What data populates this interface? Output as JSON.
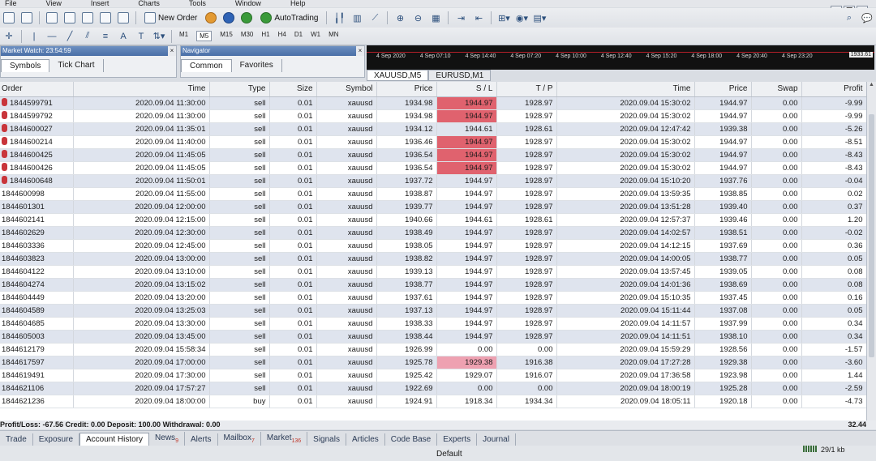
{
  "menu": [
    "File",
    "View",
    "Insert",
    "Charts",
    "Tools",
    "Window",
    "Help"
  ],
  "toolbar": {
    "new_order": "New Order",
    "auto_trading": "AutoTrading",
    "timeframes": [
      "M1",
      "M5",
      "M15",
      "M30",
      "H1",
      "H4",
      "D1",
      "W1",
      "MN"
    ],
    "active_timeframe": "M5"
  },
  "market_watch": {
    "title": "Market Watch: 23:54:59",
    "tabs": [
      "Symbols",
      "Tick Chart"
    ]
  },
  "navigator": {
    "title": "Navigator",
    "tabs": [
      "Common",
      "Favorites"
    ]
  },
  "chart": {
    "time_labels": [
      "4 Sep 2020",
      "4 Sep 07:10",
      "4 Sep 14:40",
      "4 Sep 07:20",
      "4 Sep 10:00",
      "4 Sep 12:40",
      "4 Sep 15:20",
      "4 Sep 18:00",
      "4 Sep 20:40",
      "4 Sep 23:20"
    ],
    "price_label": "1933.61",
    "tabs": [
      "XAUUSD,M5",
      "EURUSD,M1"
    ]
  },
  "columns": [
    "Order",
    "Time",
    "Type",
    "Size",
    "Symbol",
    "Price",
    "S / L",
    "T / P",
    "Time",
    "Price",
    "Swap",
    "Profit"
  ],
  "orders": [
    {
      "order": "1844599791",
      "open_time": "2020.09.04 11:30:00",
      "type": "sell",
      "size": "0.01",
      "symbol": "xauusd",
      "price": "1934.98",
      "sl": "1944.97",
      "tp": "1928.97",
      "close_time": "2020.09.04 15:30:02",
      "close_price": "1944.97",
      "swap": "0.00",
      "profit": "-9.99",
      "sl_mark": "red"
    },
    {
      "order": "1844599792",
      "open_time": "2020.09.04 11:30:00",
      "type": "sell",
      "size": "0.01",
      "symbol": "xauusd",
      "price": "1934.98",
      "sl": "1944.97",
      "tp": "1928.97",
      "close_time": "2020.09.04 15:30:02",
      "close_price": "1944.97",
      "swap": "0.00",
      "profit": "-9.99",
      "sl_mark": "red"
    },
    {
      "order": "1844600027",
      "open_time": "2020.09.04 11:35:01",
      "type": "sell",
      "size": "0.01",
      "symbol": "xauusd",
      "price": "1934.12",
      "sl": "1944.61",
      "tp": "1928.61",
      "close_time": "2020.09.04 12:47:42",
      "close_price": "1939.38",
      "swap": "0.00",
      "profit": "-5.26",
      "sl_mark": ""
    },
    {
      "order": "1844600214",
      "open_time": "2020.09.04 11:40:00",
      "type": "sell",
      "size": "0.01",
      "symbol": "xauusd",
      "price": "1936.46",
      "sl": "1944.97",
      "tp": "1928.97",
      "close_time": "2020.09.04 15:30:02",
      "close_price": "1944.97",
      "swap": "0.00",
      "profit": "-8.51",
      "sl_mark": "red"
    },
    {
      "order": "1844600425",
      "open_time": "2020.09.04 11:45:05",
      "type": "sell",
      "size": "0.01",
      "symbol": "xauusd",
      "price": "1936.54",
      "sl": "1944.97",
      "tp": "1928.97",
      "close_time": "2020.09.04 15:30:02",
      "close_price": "1944.97",
      "swap": "0.00",
      "profit": "-8.43",
      "sl_mark": "red"
    },
    {
      "order": "1844600426",
      "open_time": "2020.09.04 11:45:05",
      "type": "sell",
      "size": "0.01",
      "symbol": "xauusd",
      "price": "1936.54",
      "sl": "1944.97",
      "tp": "1928.97",
      "close_time": "2020.09.04 15:30:02",
      "close_price": "1944.97",
      "swap": "0.00",
      "profit": "-8.43",
      "sl_mark": "red"
    },
    {
      "order": "1844600648",
      "open_time": "2020.09.04 11:50:01",
      "type": "sell",
      "size": "0.01",
      "symbol": "xauusd",
      "price": "1937.72",
      "sl": "1944.97",
      "tp": "1928.97",
      "close_time": "2020.09.04 15:10:20",
      "close_price": "1937.76",
      "swap": "0.00",
      "profit": "-0.04",
      "sl_mark": ""
    },
    {
      "order": "1844600998",
      "open_time": "2020.09.04 11:55:00",
      "type": "sell",
      "size": "0.01",
      "symbol": "xauusd",
      "price": "1938.87",
      "sl": "1944.97",
      "tp": "1928.97",
      "close_time": "2020.09.04 13:59:35",
      "close_price": "1938.85",
      "swap": "0.00",
      "profit": "0.02",
      "sl_mark": ""
    },
    {
      "order": "1844601301",
      "open_time": "2020.09.04 12:00:00",
      "type": "sell",
      "size": "0.01",
      "symbol": "xauusd",
      "price": "1939.77",
      "sl": "1944.97",
      "tp": "1928.97",
      "close_time": "2020.09.04 13:51:28",
      "close_price": "1939.40",
      "swap": "0.00",
      "profit": "0.37",
      "sl_mark": ""
    },
    {
      "order": "1844602141",
      "open_time": "2020.09.04 12:15:00",
      "type": "sell",
      "size": "0.01",
      "symbol": "xauusd",
      "price": "1940.66",
      "sl": "1944.61",
      "tp": "1928.61",
      "close_time": "2020.09.04 12:57:37",
      "close_price": "1939.46",
      "swap": "0.00",
      "profit": "1.20",
      "sl_mark": ""
    },
    {
      "order": "1844602629",
      "open_time": "2020.09.04 12:30:00",
      "type": "sell",
      "size": "0.01",
      "symbol": "xauusd",
      "price": "1938.49",
      "sl": "1944.97",
      "tp": "1928.97",
      "close_time": "2020.09.04 14:02:57",
      "close_price": "1938.51",
      "swap": "0.00",
      "profit": "-0.02",
      "sl_mark": ""
    },
    {
      "order": "1844603336",
      "open_time": "2020.09.04 12:45:00",
      "type": "sell",
      "size": "0.01",
      "symbol": "xauusd",
      "price": "1938.05",
      "sl": "1944.97",
      "tp": "1928.97",
      "close_time": "2020.09.04 14:12:15",
      "close_price": "1937.69",
      "swap": "0.00",
      "profit": "0.36",
      "sl_mark": ""
    },
    {
      "order": "1844603823",
      "open_time": "2020.09.04 13:00:00",
      "type": "sell",
      "size": "0.01",
      "symbol": "xauusd",
      "price": "1938.82",
      "sl": "1944.97",
      "tp": "1928.97",
      "close_time": "2020.09.04 14:00:05",
      "close_price": "1938.77",
      "swap": "0.00",
      "profit": "0.05",
      "sl_mark": ""
    },
    {
      "order": "1844604122",
      "open_time": "2020.09.04 13:10:00",
      "type": "sell",
      "size": "0.01",
      "symbol": "xauusd",
      "price": "1939.13",
      "sl": "1944.97",
      "tp": "1928.97",
      "close_time": "2020.09.04 13:57:45",
      "close_price": "1939.05",
      "swap": "0.00",
      "profit": "0.08",
      "sl_mark": ""
    },
    {
      "order": "1844604274",
      "open_time": "2020.09.04 13:15:02",
      "type": "sell",
      "size": "0.01",
      "symbol": "xauusd",
      "price": "1938.77",
      "sl": "1944.97",
      "tp": "1928.97",
      "close_time": "2020.09.04 14:01:36",
      "close_price": "1938.69",
      "swap": "0.00",
      "profit": "0.08",
      "sl_mark": ""
    },
    {
      "order": "1844604449",
      "open_time": "2020.09.04 13:20:00",
      "type": "sell",
      "size": "0.01",
      "symbol": "xauusd",
      "price": "1937.61",
      "sl": "1944.97",
      "tp": "1928.97",
      "close_time": "2020.09.04 15:10:35",
      "close_price": "1937.45",
      "swap": "0.00",
      "profit": "0.16",
      "sl_mark": ""
    },
    {
      "order": "1844604589",
      "open_time": "2020.09.04 13:25:03",
      "type": "sell",
      "size": "0.01",
      "symbol": "xauusd",
      "price": "1937.13",
      "sl": "1944.97",
      "tp": "1928.97",
      "close_time": "2020.09.04 15:11:44",
      "close_price": "1937.08",
      "swap": "0.00",
      "profit": "0.05",
      "sl_mark": ""
    },
    {
      "order": "1844604685",
      "open_time": "2020.09.04 13:30:00",
      "type": "sell",
      "size": "0.01",
      "symbol": "xauusd",
      "price": "1938.33",
      "sl": "1944.97",
      "tp": "1928.97",
      "close_time": "2020.09.04 14:11:57",
      "close_price": "1937.99",
      "swap": "0.00",
      "profit": "0.34",
      "sl_mark": ""
    },
    {
      "order": "1844605003",
      "open_time": "2020.09.04 13:45:00",
      "type": "sell",
      "size": "0.01",
      "symbol": "xauusd",
      "price": "1938.44",
      "sl": "1944.97",
      "tp": "1928.97",
      "close_time": "2020.09.04 14:11:51",
      "close_price": "1938.10",
      "swap": "0.00",
      "profit": "0.34",
      "sl_mark": ""
    },
    {
      "order": "1844612179",
      "open_time": "2020.09.04 15:58:34",
      "type": "sell",
      "size": "0.01",
      "symbol": "xauusd",
      "price": "1926.99",
      "sl": "0.00",
      "tp": "0.00",
      "close_time": "2020.09.04 15:59:29",
      "close_price": "1928.56",
      "swap": "0.00",
      "profit": "-1.57",
      "sl_mark": ""
    },
    {
      "order": "1844617597",
      "open_time": "2020.09.04 17:00:00",
      "type": "sell",
      "size": "0.01",
      "symbol": "xauusd",
      "price": "1925.78",
      "sl": "1929.38",
      "tp": "1916.38",
      "close_time": "2020.09.04 17:27:28",
      "close_price": "1929.38",
      "swap": "0.00",
      "profit": "-3.60",
      "sl_mark": "pink"
    },
    {
      "order": "1844619491",
      "open_time": "2020.09.04 17:30:00",
      "type": "sell",
      "size": "0.01",
      "symbol": "xauusd",
      "price": "1925.42",
      "sl": "1929.07",
      "tp": "1916.07",
      "close_time": "2020.09.04 17:36:58",
      "close_price": "1923.98",
      "swap": "0.00",
      "profit": "1.44",
      "sl_mark": ""
    },
    {
      "order": "1844621106",
      "open_time": "2020.09.04 17:57:27",
      "type": "sell",
      "size": "0.01",
      "symbol": "xauusd",
      "price": "1922.69",
      "sl": "0.00",
      "tp": "0.00",
      "close_time": "2020.09.04 18:00:19",
      "close_price": "1925.28",
      "swap": "0.00",
      "profit": "-2.59",
      "sl_mark": ""
    },
    {
      "order": "1844621236",
      "open_time": "2020.09.04 18:00:00",
      "type": "buy",
      "size": "0.01",
      "symbol": "xauusd",
      "price": "1924.91",
      "sl": "1918.34",
      "tp": "1934.34",
      "close_time": "2020.09.04 18:05:11",
      "close_price": "1920.18",
      "swap": "0.00",
      "profit": "-4.73",
      "sl_mark": ""
    }
  ],
  "summary": {
    "text": "Profit/Loss: -67.56  Credit: 0.00  Deposit: 100.00  Withdrawal: 0.00",
    "total": "32.44"
  },
  "bottom_tabs": [
    {
      "label": "Trade",
      "badge": ""
    },
    {
      "label": "Exposure",
      "badge": ""
    },
    {
      "label": "Account History",
      "badge": ""
    },
    {
      "label": "News",
      "badge": "9"
    },
    {
      "label": "Alerts",
      "badge": ""
    },
    {
      "label": "Mailbox",
      "badge": "7"
    },
    {
      "label": "Market",
      "badge": "136"
    },
    {
      "label": "Signals",
      "badge": ""
    },
    {
      "label": "Articles",
      "badge": ""
    },
    {
      "label": "Code Base",
      "badge": ""
    },
    {
      "label": "Experts",
      "badge": ""
    },
    {
      "label": "Journal",
      "badge": ""
    }
  ],
  "active_bottom_tab": "Account History",
  "status": {
    "profile": "Default",
    "traffic": "29/1 kb"
  }
}
